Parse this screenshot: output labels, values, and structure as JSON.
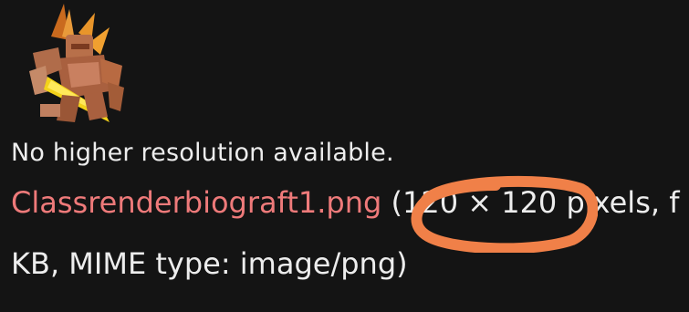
{
  "page": {
    "background_color": "#141414",
    "text_color": "#ededed",
    "link_color": "#ee7a7a",
    "annotation_color": "#f08048"
  },
  "image_preview": {
    "icon": "robot-character-render-icon"
  },
  "file_info": {
    "status_text": "No higher resolution available.",
    "file_name": "Classrenderbiograft1.png",
    "open_paren": " (",
    "dimensions": "120 × 120",
    "details_tail": " pixels, f",
    "details_line2": "KB, MIME type: image/png)"
  },
  "annotation": {
    "shape": "hand-drawn-circle",
    "color": "#f08048"
  }
}
